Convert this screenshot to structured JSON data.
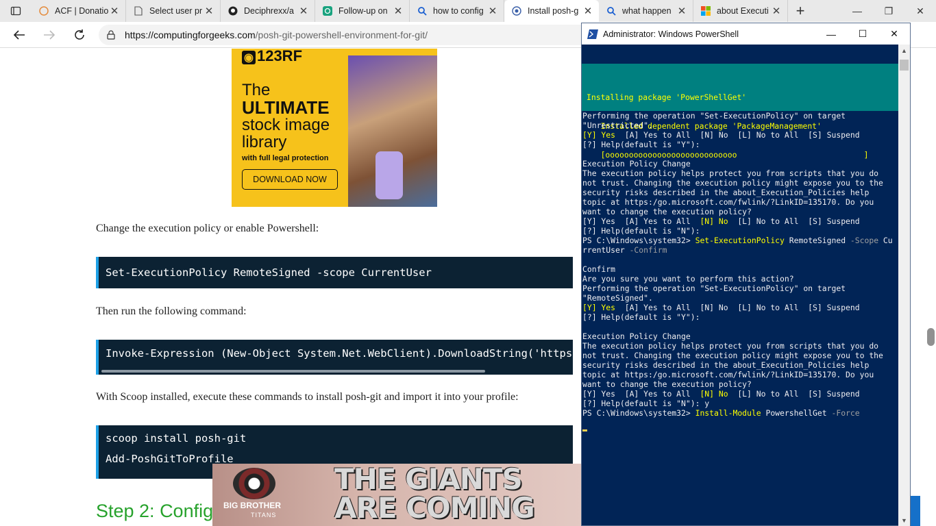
{
  "tabs": [
    {
      "title": "ACF | Donatio",
      "icon": "acf-favicon"
    },
    {
      "title": "Select user pr",
      "icon": "page-icon"
    },
    {
      "title": "Deciphrexx/a",
      "icon": "github-icon"
    },
    {
      "title": "Follow-up on",
      "icon": "chatgpt-icon"
    },
    {
      "title": "how to config",
      "icon": "search-icon"
    },
    {
      "title": "Install posh-g",
      "icon": "site-favicon",
      "active": true
    },
    {
      "title": "what happen",
      "icon": "search-icon"
    },
    {
      "title": "about Executi",
      "icon": "windows-icon"
    }
  ],
  "address": {
    "host": "https://computingforgeeks.com",
    "path": "/posh-git-powershell-environment-for-git/"
  },
  "ad": {
    "brand": "123RF",
    "line1": "The",
    "line2": "ULTIMATE",
    "line3": "stock image",
    "line4": "library",
    "line5": "with full legal protection",
    "cta": "DOWNLOAD NOW"
  },
  "article": {
    "p1": "Change the execution policy or enable Powershell:",
    "code1": "Set-ExecutionPolicy RemoteSigned -scope CurrentUser",
    "p2": "Then run the following command:",
    "code2": "Invoke-Expression (New-Object System.Net.WebClient).DownloadString('https",
    "p3": "With Scoop installed, execute these commands to install posh-git and import it into your profile:",
    "code3": [
      "scoop install posh-git",
      "Add-PoshGitToProfile"
    ],
    "h2": "Step 2: Config"
  },
  "banner": {
    "brand": "BIG BROTHER",
    "sub": "TITANS",
    "headline1": "THE GIANTS",
    "headline2": "ARE COMING"
  },
  "powershell": {
    "title": "Administrator: Windows PowerShell",
    "progress": [
      "Installing package 'PowerShellGet'",
      "   Installed dependent package 'PackageManagement'",
      "   [oooooooooooooooooooooooooooo                           ]"
    ],
    "lines": [
      "Performing the operation \"Set-ExecutionPolicy\" on target",
      "\"Unrestricted\".",
      "YES_ROW",
      "[?] Help(default is \"Y\"):",
      "",
      "Execution Policy Change",
      "The execution policy helps protect you from scripts that you do",
      "not trust. Changing the execution policy might expose you to the",
      "security risks described in the about_Execution_Policies help",
      "topic at https:/go.microsoft.com/fwlink/?LinkID=135170. Do you",
      "want to change the execution policy?",
      "NO_ROW",
      "[?] Help(default is \"N\"):",
      "CMD1",
      "rrentUser -Confirm",
      "",
      "Confirm",
      "Are you sure you want to perform this action?",
      "Performing the operation \"Set-ExecutionPolicy\" on target",
      "\"RemoteSigned\".",
      "YES_ROW",
      "[?] Help(default is \"Y\"):",
      "",
      "Execution Policy Change",
      "The execution policy helps protect you from scripts that you do",
      "not trust. Changing the execution policy might expose you to the",
      "security risks described in the about_Execution_Policies help",
      "topic at https:/go.microsoft.com/fwlink/?LinkID=135170. Do you",
      "want to change the execution policy?",
      "NO_ROW",
      "[?] Help(default is \"N\"): y",
      "CMD2"
    ],
    "prompt": "PS C:\\Windows\\system32> ",
    "cmd1": {
      "verb": "Set-ExecutionPolicy",
      "arg": " RemoteSigned ",
      "param": "-Scope",
      "rest": " Cu"
    },
    "cmd2": {
      "verb": "Install-Module",
      "arg": " PowershellGet ",
      "param": "-Force"
    },
    "yes_default": "[Y] Yes",
    "choices_after_yes": "  [A] Yes to All  [N] No  [L] No to All  [S] Suspend",
    "choices_before_no": "[Y] Yes  [A] Yes to All  ",
    "no_default": "[N] No",
    "choices_after_no": "  [L] No to All  [S] Suspend"
  },
  "colors": {
    "ps_bg": "#012456",
    "ps_progress": "#008080",
    "yellow": "#ffff00",
    "code_bg": "#0c2233",
    "code_accent": "#1ea0e6",
    "heading_green": "#27a22c"
  }
}
